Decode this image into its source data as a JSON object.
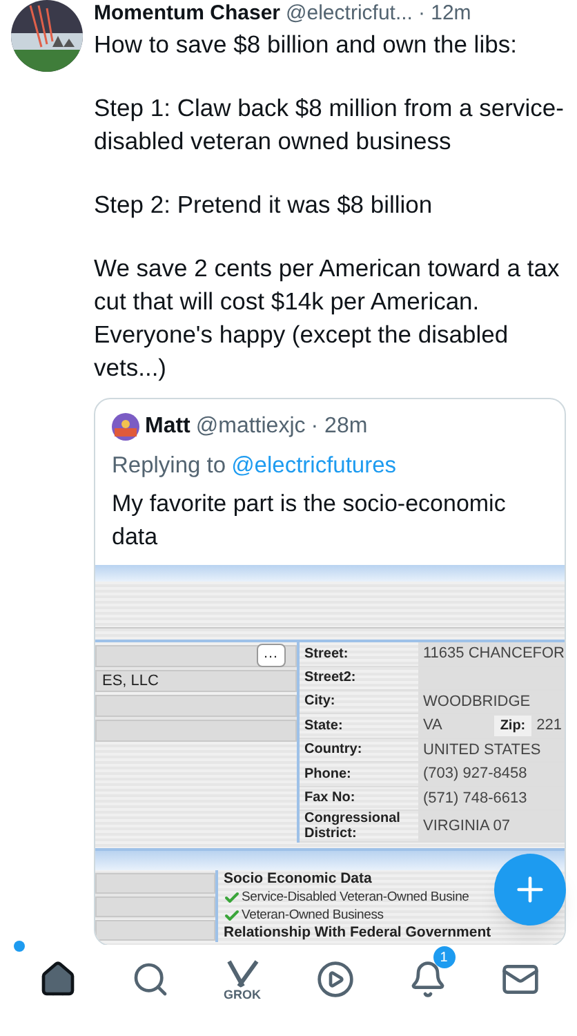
{
  "tweet": {
    "author": "Momentum Chaser",
    "handle": "@electricfut...",
    "time": "· 12m",
    "paragraphs": [
      "How to save $8 billion and own the libs:",
      "Step 1: Claw back $8 million from a service-disabled veteran owned business",
      "Step 2: Pretend it was $8 billion",
      "We save 2 cents per American toward a tax cut that will cost $14k per American. Everyone's happy (except the disabled vets...)"
    ]
  },
  "quote": {
    "author": "Matt",
    "handle": "@mattiexjc",
    "time": "· 28m",
    "replying_label": "Replying to",
    "replying_to": "@electricfutures",
    "text": "My favorite part is the socio-economic data",
    "document": {
      "left_fields": [
        {
          "kind": "with_button"
        },
        {
          "kind": "text",
          "value": "ES, LLC"
        },
        {
          "kind": "empty"
        },
        {
          "kind": "empty"
        }
      ],
      "more_label": "…",
      "address": [
        {
          "label": "Street:",
          "value": "11635 CHANCEFOR"
        },
        {
          "label": "Street2:"
        },
        {
          "label": "City:",
          "value": "WOODBRIDGE"
        },
        {
          "label": "State:",
          "value": "VA",
          "extra_label": "Zip:",
          "extra_value": "221"
        },
        {
          "label": "Country:",
          "value": "UNITED STATES"
        },
        {
          "label": "Phone:",
          "value": "(703) 927-8458"
        },
        {
          "label": "Fax No:",
          "value": "(571) 748-6613"
        },
        {
          "label": "Congressional District:",
          "value": "VIRGINIA 07"
        }
      ],
      "sections": [
        {
          "kind": "heading",
          "text": "Socio Economic Data"
        },
        {
          "kind": "checked",
          "text": "Service-Disabled Veteran-Owned Busine"
        },
        {
          "kind": "checked",
          "text": "Veteran-Owned Business"
        },
        {
          "kind": "heading",
          "text": "Relationship With Federal Government"
        }
      ]
    }
  },
  "nav": [
    {
      "kind": "home",
      "selected": true,
      "dot": true
    },
    {
      "kind": "search",
      "selected": false
    },
    {
      "kind": "grok",
      "label": "GROK",
      "selected": false
    },
    {
      "kind": "play",
      "selected": false
    },
    {
      "kind": "bell",
      "selected": false,
      "badge": "1"
    },
    {
      "kind": "mail",
      "selected": false
    }
  ]
}
